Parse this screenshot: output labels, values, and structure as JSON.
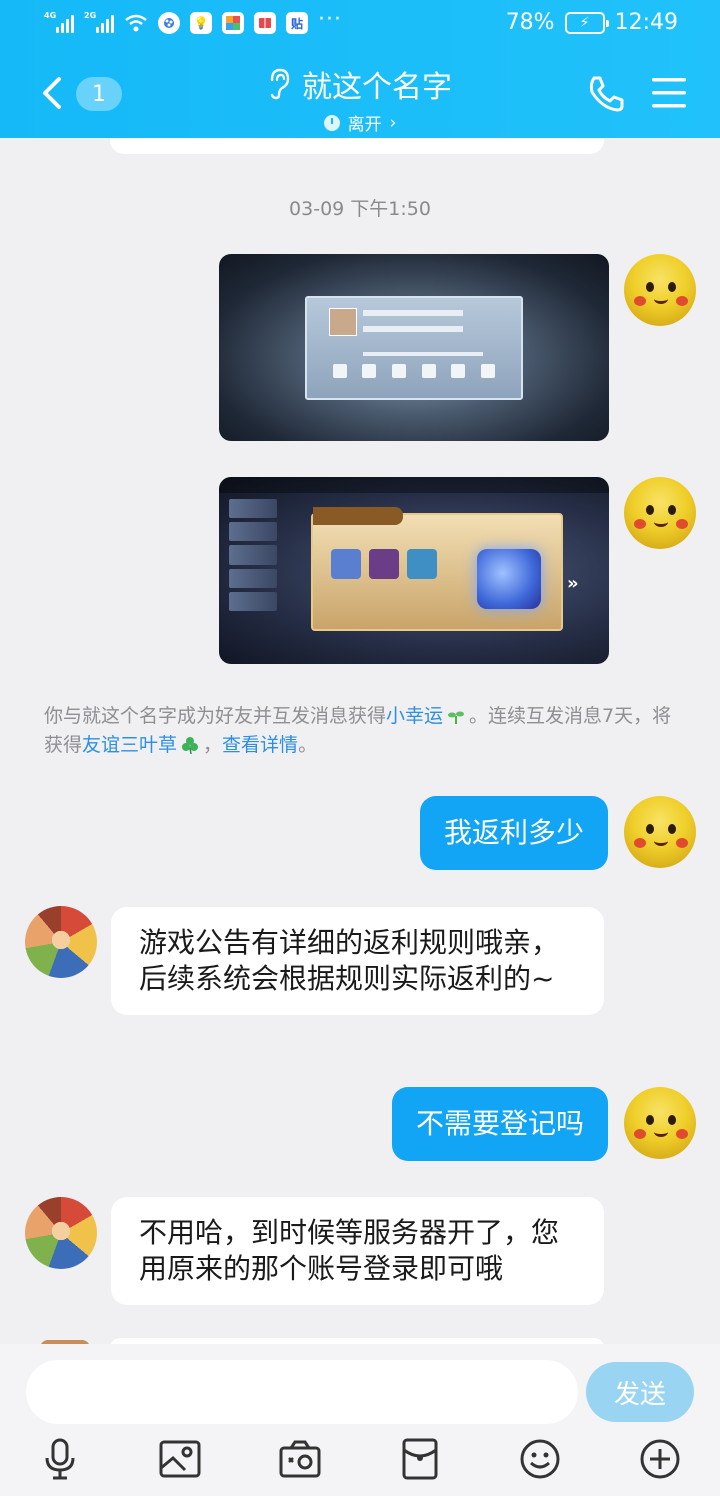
{
  "status_bar": {
    "signal1_label": "4G",
    "signal2_label": "2G",
    "app_icon_label": "贴",
    "more": "···",
    "battery": "78%",
    "time": "12:49"
  },
  "header": {
    "unread_count": "1",
    "contact_name": "就这个名字",
    "presence": "离开",
    "presence_chevron": "›"
  },
  "chat": {
    "timestamp": "03-09 下午1:50",
    "system_tip": {
      "part1": "你与就这个名字成为好友并互发消息获得",
      "link1": "小幸运",
      "part2": "。连续互发消息7天，将获得",
      "link2": "友谊三叶草",
      "part3": "，",
      "link3": "查看详情",
      "part4": "。"
    },
    "messages": [
      {
        "sender": "me",
        "text": "我返利多少"
      },
      {
        "sender": "other",
        "text": "游戏公告有详细的返利规则哦亲，后续系统会根据规则实际返利的~"
      },
      {
        "sender": "me",
        "text": "不需要登记吗"
      },
      {
        "sender": "other",
        "text": "不用哈，到时候等服务器开了，您用原来的那个账号登录即可哦"
      }
    ]
  },
  "input": {
    "placeholder": "",
    "send_label": "发送"
  },
  "colors": {
    "header_bg": "#1ab8f8",
    "my_bubble": "#12a4f5",
    "link": "#2d8fe0",
    "send_btn": "#99d4f3"
  }
}
